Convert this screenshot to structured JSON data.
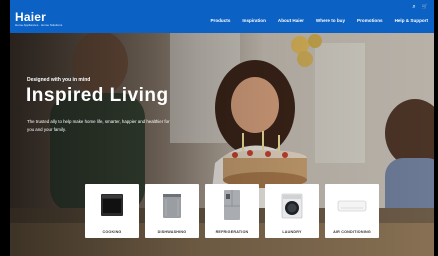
{
  "brand": {
    "logo": "Haier",
    "tagline": "Home Appliances · Home Solutions"
  },
  "utility": {
    "search_icon": "⌕",
    "cart_icon": "🛒"
  },
  "nav": [
    "Products",
    "Inspiration",
    "About Haier",
    "Where to buy",
    "Promotions",
    "Help & Support"
  ],
  "hero": {
    "eyebrow": "Designed with you in mind",
    "headline": "Inspired Living",
    "body": "The trusted ally to help make home life, smarter, happier and healthier for you and your family."
  },
  "categories": [
    {
      "label": "COOKING",
      "icon": "oven-icon"
    },
    {
      "label": "DISHWASHING",
      "icon": "dishwasher-icon"
    },
    {
      "label": "REFRIGERATION",
      "icon": "fridge-icon"
    },
    {
      "label": "LAUNDRY",
      "icon": "washing-machine-icon"
    },
    {
      "label": "AIR CONDITIONING",
      "icon": "air-conditioner-icon"
    }
  ],
  "colors": {
    "nav": "#0b62c4",
    "card": "#ffffff"
  }
}
